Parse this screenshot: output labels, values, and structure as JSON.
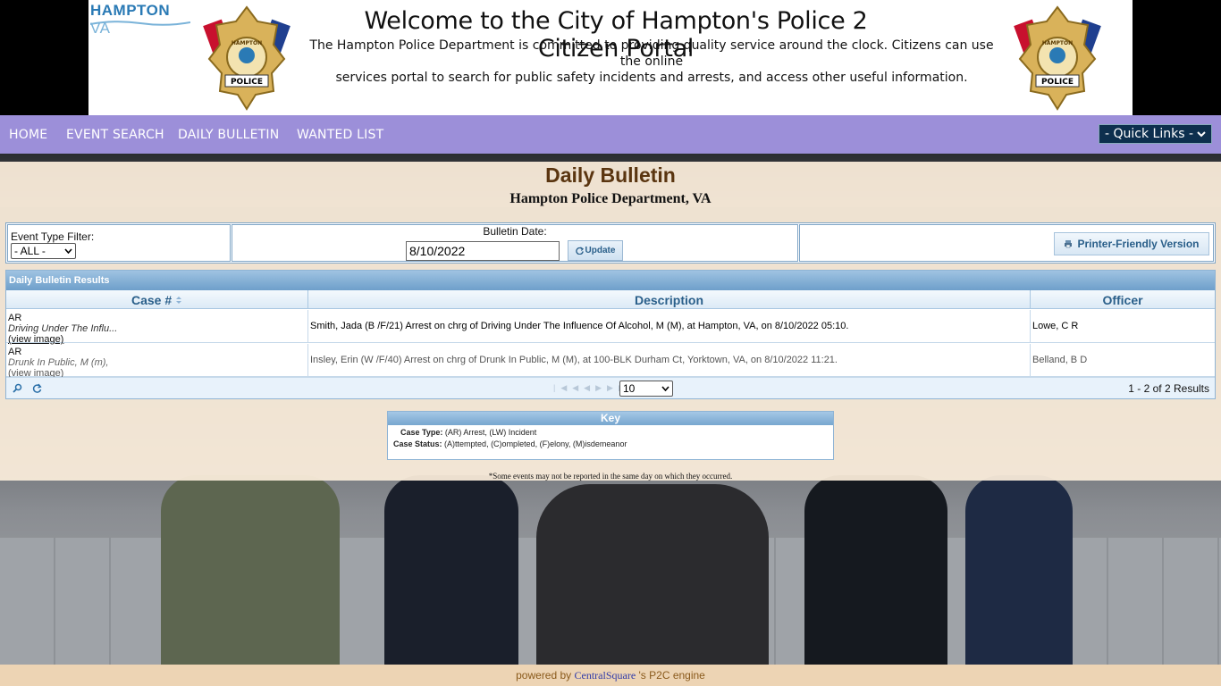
{
  "banner": {
    "city_logo": "HAMPTON",
    "city_logo_suffix": "VA",
    "title": "Welcome to the City of Hampton's Police 2 Citizen Portal",
    "subtitle_line1": "The Hampton Police Department is committed to providing quality service around the clock.  Citizens can use the online",
    "subtitle_line2": "services portal to search for public safety incidents and arrests,  and access other useful information.",
    "badge_text_city": "HAMPTON",
    "badge_text_police": "POLICE"
  },
  "nav": {
    "home": "HOME",
    "event_search": "EVENT SEARCH",
    "daily_bulletin": "DAILY BULLETIN",
    "wanted_list": "WANTED LIST",
    "quick_links": "- Quick Links -"
  },
  "page": {
    "title": "Daily Bulletin",
    "subtitle": "Hampton Police Department, VA"
  },
  "filters": {
    "event_type_label": "Event Type Filter:",
    "event_type_value": "- ALL -",
    "bulletin_date_label": "Bulletin Date:",
    "bulletin_date_value": "8/10/2022",
    "update_label": "Update",
    "printer_label": "Printer-Friendly Version"
  },
  "grid": {
    "caption": "Daily Bulletin Results",
    "columns": [
      "Case #",
      "Description",
      "Officer"
    ],
    "rows": [
      {
        "type": "AR",
        "case_desc": "Driving Under The Influ...",
        "view_image": "(view image)",
        "description": "Smith, Jada (B /F/21) Arrest on chrg of Driving Under The Influence Of Alcohol, M (M), at Hampton, VA, on 8/10/2022 05:10.",
        "officer": "Lowe, C R"
      },
      {
        "type": "AR",
        "case_desc": "Drunk In Public, M (m),",
        "view_image": "(view image)",
        "description": "Insley, Erin (W /F/40) Arrest on chrg of Drunk In Public, M (M), at 100-BLK Durham Ct, Yorktown, VA, on 8/10/2022 11:21.",
        "officer": "Belland, B D"
      }
    ],
    "page_size": "10",
    "results": "1 - 2 of 2 Results"
  },
  "key": {
    "title": "Key",
    "case_type_label": "Case Type:",
    "case_type_value": "(AR) Arrest, (LW) Incident",
    "case_status_label": "Case Status:",
    "case_status_value": "(A)ttempted, (C)ompleted, (F)elony, (M)isdemeanor"
  },
  "footnote": "*Some events may not be reported in the same day on which they occurred.",
  "footer": {
    "prefix": "powered by",
    "link": "CentralSquare",
    "suffix": "'s P2C engine"
  },
  "colors": {
    "nav_bg": "#9c8fd9",
    "title_brown": "#5a3510",
    "grid_blue": "#2a5f8a",
    "footer_bg": "#edd4b4"
  }
}
